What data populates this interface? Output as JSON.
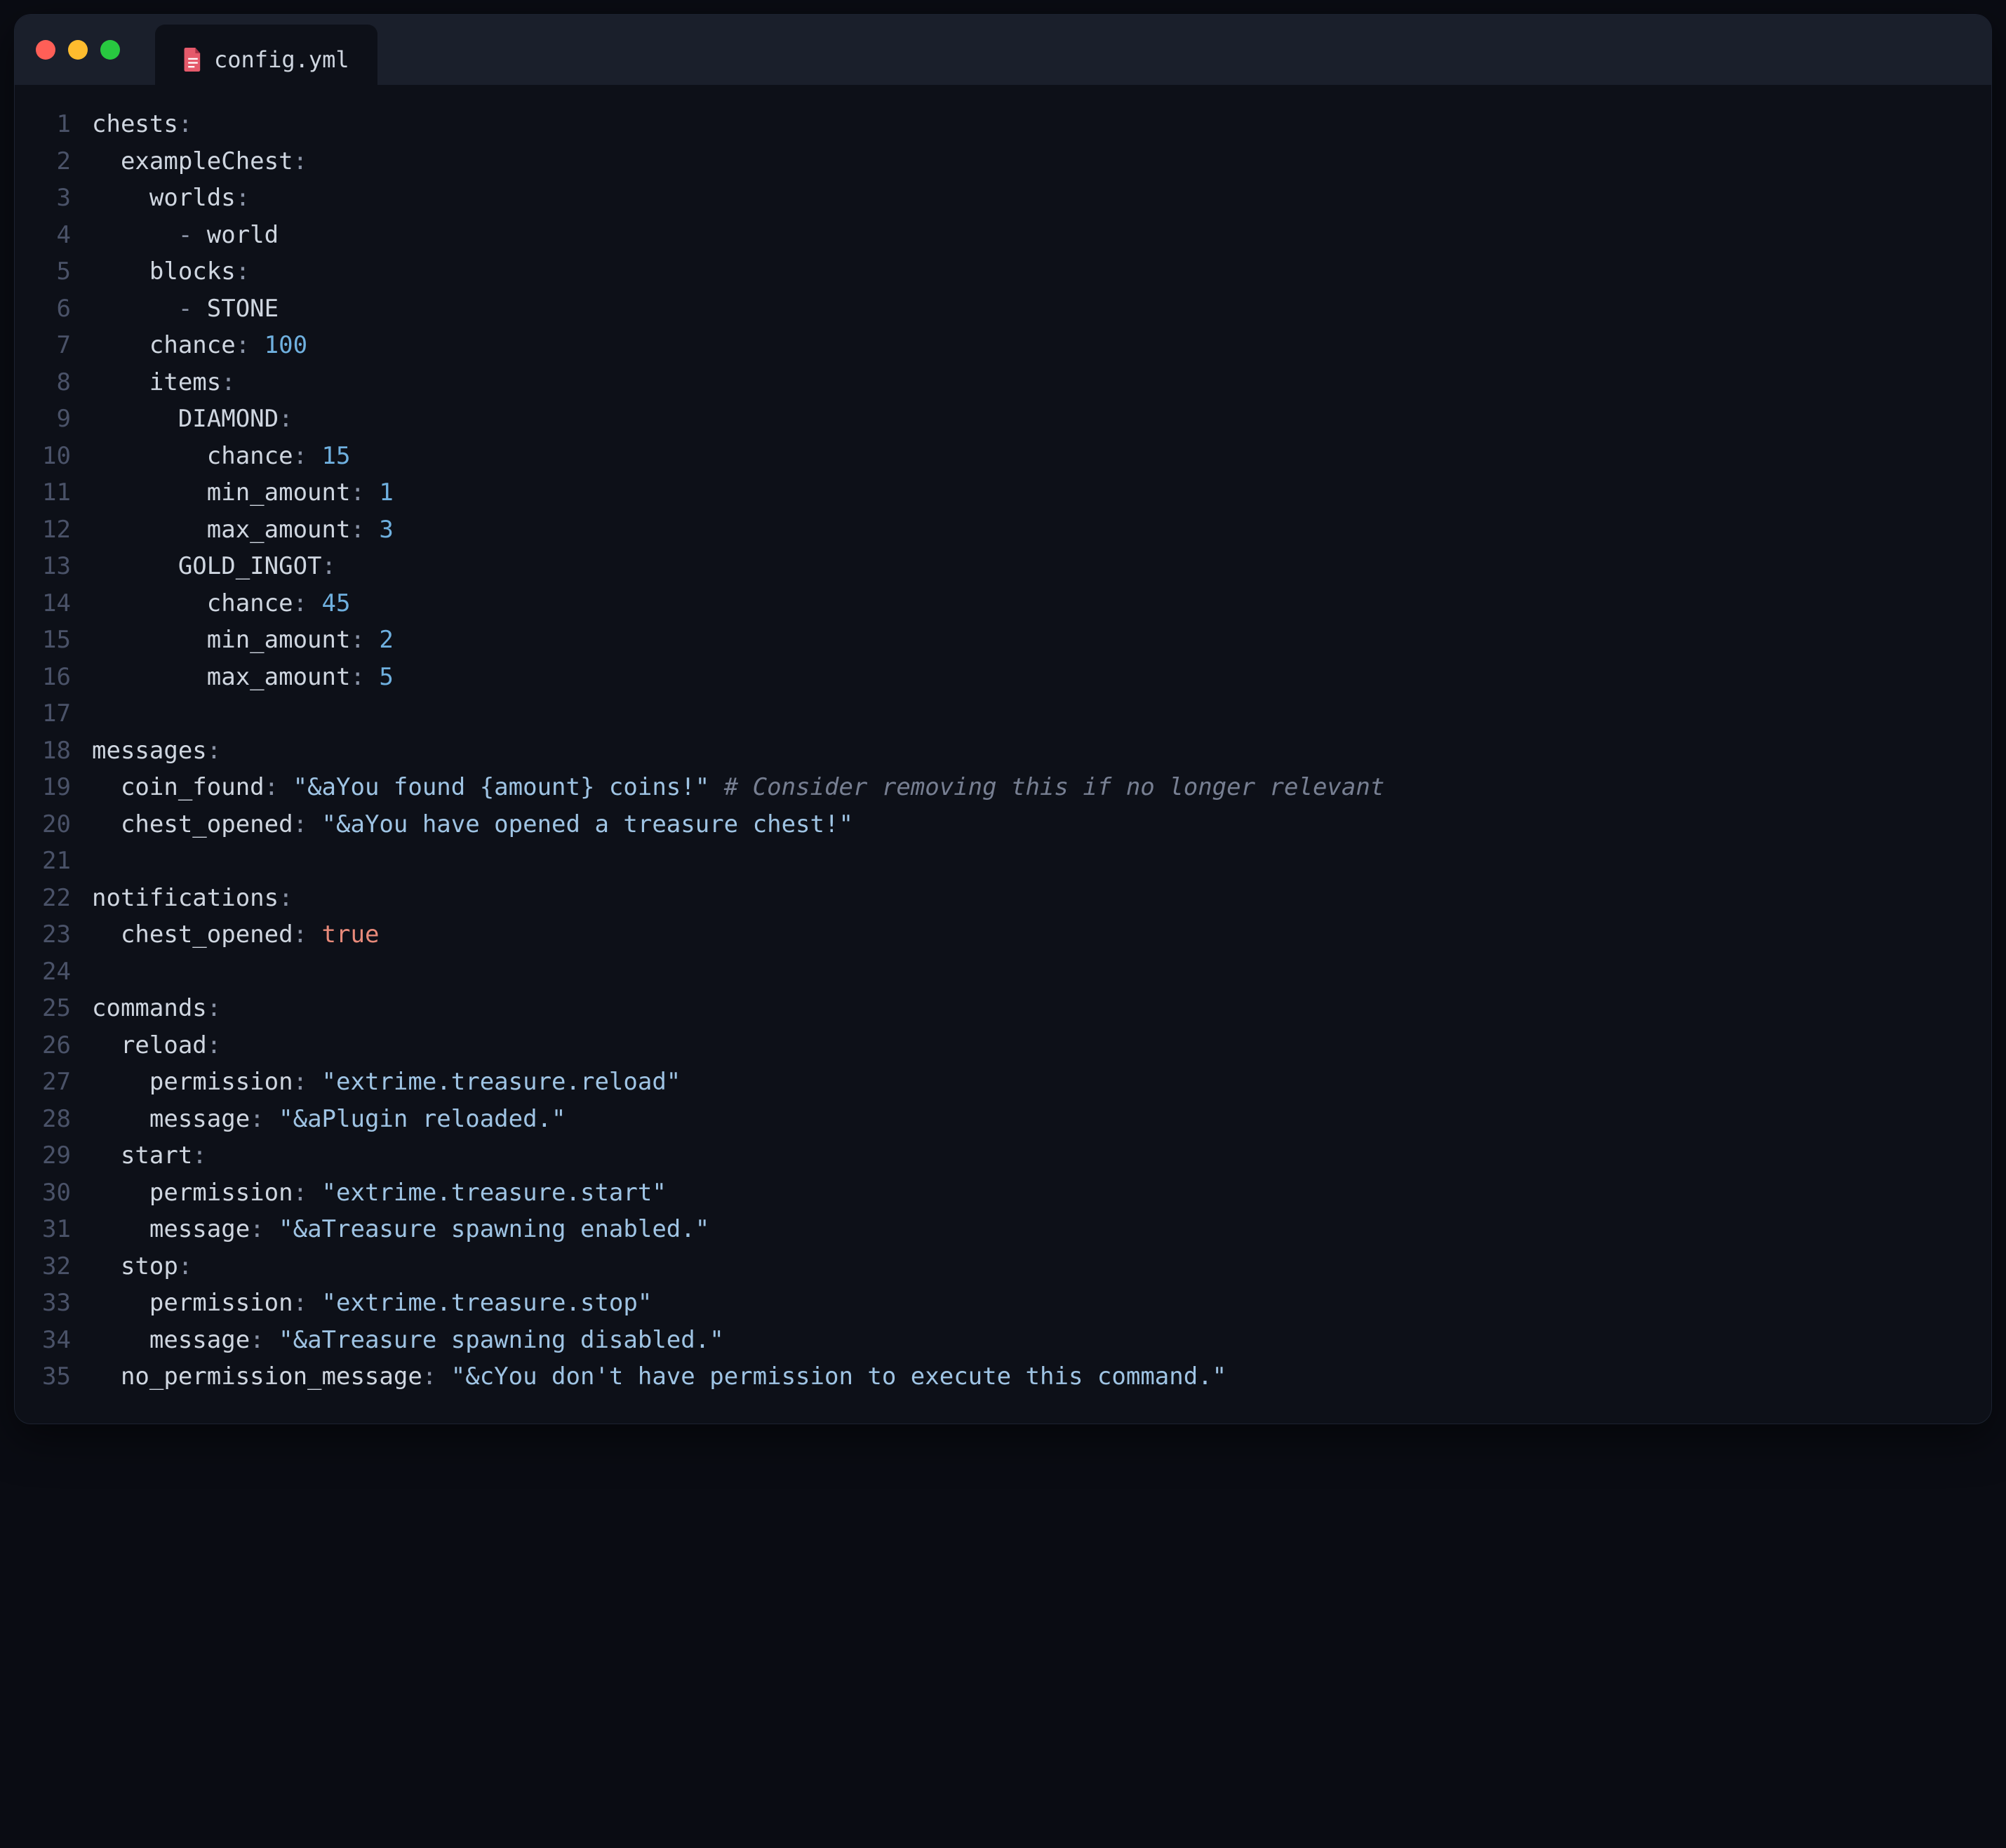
{
  "tab": {
    "filename": "config.yml"
  },
  "gutter": {
    "start": 1,
    "end": 35
  },
  "code": {
    "lines": [
      [
        [
          "k",
          "chests"
        ],
        [
          "p",
          ":"
        ]
      ],
      [
        [
          "k",
          "  exampleChest"
        ],
        [
          "p",
          ":"
        ]
      ],
      [
        [
          "k",
          "    worlds"
        ],
        [
          "p",
          ":"
        ]
      ],
      [
        [
          "d",
          "      - "
        ],
        [
          "k",
          "world"
        ]
      ],
      [
        [
          "k",
          "    blocks"
        ],
        [
          "p",
          ":"
        ]
      ],
      [
        [
          "d",
          "      - "
        ],
        [
          "k",
          "STONE"
        ]
      ],
      [
        [
          "k",
          "    chance"
        ],
        [
          "p",
          ": "
        ],
        [
          "n",
          "100"
        ]
      ],
      [
        [
          "k",
          "    items"
        ],
        [
          "p",
          ":"
        ]
      ],
      [
        [
          "k",
          "      DIAMOND"
        ],
        [
          "p",
          ":"
        ]
      ],
      [
        [
          "k",
          "        chance"
        ],
        [
          "p",
          ": "
        ],
        [
          "n",
          "15"
        ]
      ],
      [
        [
          "k",
          "        min_amount"
        ],
        [
          "p",
          ": "
        ],
        [
          "n",
          "1"
        ]
      ],
      [
        [
          "k",
          "        max_amount"
        ],
        [
          "p",
          ": "
        ],
        [
          "n",
          "3"
        ]
      ],
      [
        [
          "k",
          "      GOLD_INGOT"
        ],
        [
          "p",
          ":"
        ]
      ],
      [
        [
          "k",
          "        chance"
        ],
        [
          "p",
          ": "
        ],
        [
          "n",
          "45"
        ]
      ],
      [
        [
          "k",
          "        min_amount"
        ],
        [
          "p",
          ": "
        ],
        [
          "n",
          "2"
        ]
      ],
      [
        [
          "k",
          "        max_amount"
        ],
        [
          "p",
          ": "
        ],
        [
          "n",
          "5"
        ]
      ],
      [],
      [
        [
          "k",
          "messages"
        ],
        [
          "p",
          ":"
        ]
      ],
      [
        [
          "k",
          "  coin_found"
        ],
        [
          "p",
          ": "
        ],
        [
          "s",
          "\"&aYou found {amount} coins!\""
        ],
        [
          "c",
          " # Consider removing this if no longer relevant"
        ]
      ],
      [
        [
          "k",
          "  chest_opened"
        ],
        [
          "p",
          ": "
        ],
        [
          "s",
          "\"&aYou have opened a treasure chest!\""
        ]
      ],
      [],
      [
        [
          "k",
          "notifications"
        ],
        [
          "p",
          ":"
        ]
      ],
      [
        [
          "k",
          "  chest_opened"
        ],
        [
          "p",
          ": "
        ],
        [
          "b",
          "true"
        ]
      ],
      [],
      [
        [
          "k",
          "commands"
        ],
        [
          "p",
          ":"
        ]
      ],
      [
        [
          "k",
          "  reload"
        ],
        [
          "p",
          ":"
        ]
      ],
      [
        [
          "k",
          "    permission"
        ],
        [
          "p",
          ": "
        ],
        [
          "s",
          "\"extrime.treasure.reload\""
        ]
      ],
      [
        [
          "k",
          "    message"
        ],
        [
          "p",
          ": "
        ],
        [
          "s",
          "\"&aPlugin reloaded.\""
        ]
      ],
      [
        [
          "k",
          "  start"
        ],
        [
          "p",
          ":"
        ]
      ],
      [
        [
          "k",
          "    permission"
        ],
        [
          "p",
          ": "
        ],
        [
          "s",
          "\"extrime.treasure.start\""
        ]
      ],
      [
        [
          "k",
          "    message"
        ],
        [
          "p",
          ": "
        ],
        [
          "s",
          "\"&aTreasure spawning enabled.\""
        ]
      ],
      [
        [
          "k",
          "  stop"
        ],
        [
          "p",
          ":"
        ]
      ],
      [
        [
          "k",
          "    permission"
        ],
        [
          "p",
          ": "
        ],
        [
          "s",
          "\"extrime.treasure.stop\""
        ]
      ],
      [
        [
          "k",
          "    message"
        ],
        [
          "p",
          ": "
        ],
        [
          "s",
          "\"&aTreasure spawning disabled.\""
        ]
      ],
      [
        [
          "k",
          "  no_permission_message"
        ],
        [
          "p",
          ": "
        ],
        [
          "s",
          "\"&cYou don't have permission to execute this command.\""
        ]
      ]
    ]
  }
}
